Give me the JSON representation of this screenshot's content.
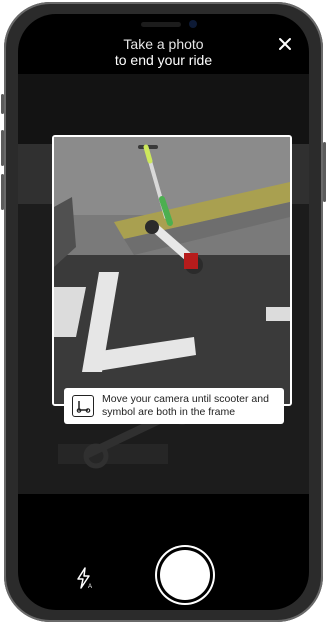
{
  "header": {
    "title_line1": "Take a photo",
    "title_line2": "to end your ride",
    "close_icon": "close-icon"
  },
  "camera": {
    "hint_text": "Move your camera until scooter and symbol are both in the frame",
    "hint_icon": "scooter-symbol-icon",
    "flash_icon": "flash-auto-icon",
    "shutter_icon": "shutter-button"
  }
}
